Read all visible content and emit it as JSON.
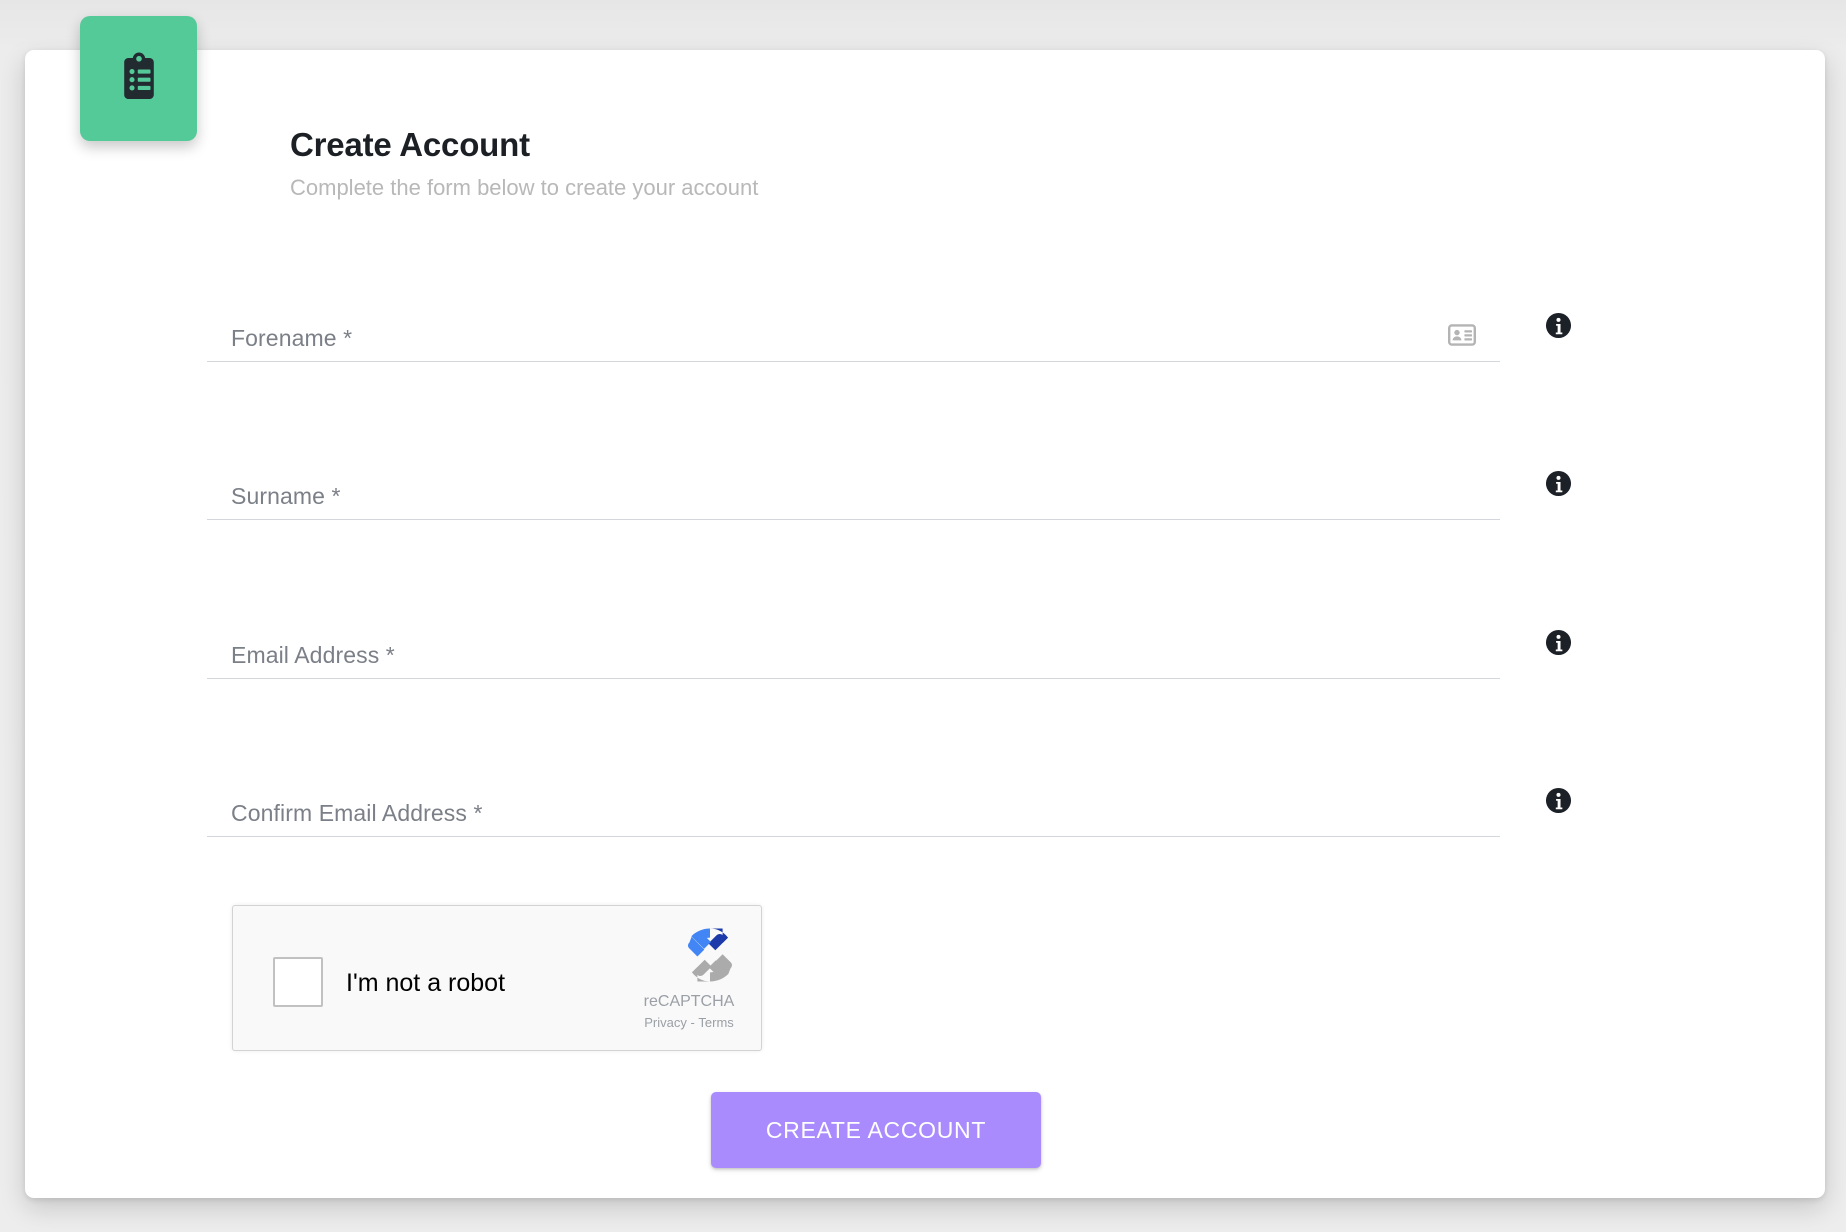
{
  "header": {
    "logo_icon": "clipboard-list-icon",
    "logo_bg_color": "#55CA99",
    "title": "Create Account",
    "subtitle": "Complete the form below to create your account"
  },
  "form": {
    "fields": [
      {
        "name": "forename",
        "label": "Forename *",
        "value": "",
        "placeholder": "Forename *",
        "trailing_icon": "contact-card-icon",
        "info_icon": "info-icon"
      },
      {
        "name": "surname",
        "label": "Surname *",
        "value": "",
        "placeholder": "Surname *",
        "trailing_icon": "",
        "info_icon": "info-icon"
      },
      {
        "name": "email",
        "label": "Email Address *",
        "value": "",
        "placeholder": "Email Address *",
        "trailing_icon": "",
        "info_icon": "info-icon"
      },
      {
        "name": "confirm_email",
        "label": "Confirm Email Address *",
        "value": "",
        "placeholder": "Confirm Email Address *",
        "trailing_icon": "",
        "info_icon": "info-icon"
      }
    ]
  },
  "recaptcha": {
    "checkbox_checked": false,
    "label": "I'm not a robot",
    "brand": "reCAPTCHA",
    "privacy_label": "Privacy",
    "separator": "-",
    "terms_label": "Terms",
    "logo_icon": "recaptcha-logo-icon"
  },
  "actions": {
    "submit_label": "CREATE ACCOUNT",
    "submit_color": "#A98BFD"
  },
  "colors": {
    "page_background": "#EBEBEB",
    "card_background": "#FFFFFF",
    "accent_green": "#55CA99",
    "accent_purple": "#A98BFD",
    "label_grey": "#7B7F87",
    "subtitle_grey": "#B8B8B8",
    "underline_grey": "#D3D6DC"
  }
}
